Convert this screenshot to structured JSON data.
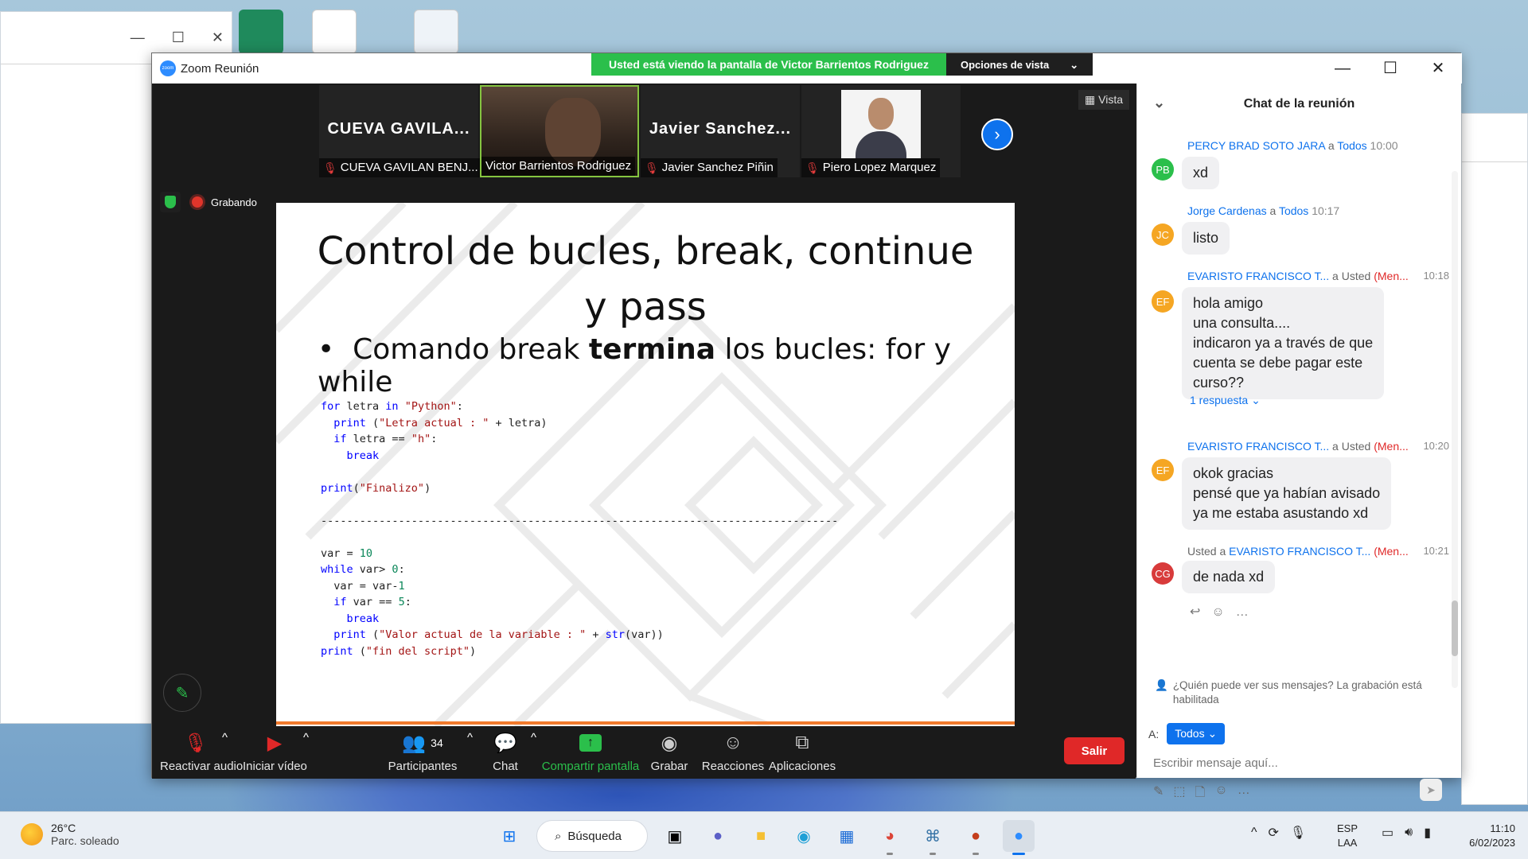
{
  "zoom": {
    "window_title": "Zoom Reunión",
    "logo_text": "zoom",
    "share_banner": "Usted está viendo la pantalla de Victor Barrientos Rodriguez",
    "view_options": "Opciones de vista",
    "view_label": "Vista",
    "recording_label": "Grabando"
  },
  "participants": [
    {
      "big_name": "CUEVA GAVILA...",
      "label": "CUEVA GAVILAN BENJ...",
      "muted": true
    },
    {
      "big_name": "",
      "label": "Victor Barrientos Rodriguez",
      "muted": false
    },
    {
      "big_name": "Javier Sanchez...",
      "label": "Javier Sanchez Piñin",
      "muted": true
    },
    {
      "big_name": "",
      "label": "Piero Lopez Marquez",
      "muted": true
    }
  ],
  "slide": {
    "title_line1": "Control de bucles, break, continue",
    "title_line2": "y pass",
    "bullet_pre": "Comando break ",
    "bullet_bold": "termina",
    "bullet_post": " los bucles: for y while",
    "separator": "--------------------------------------------------------------------------------"
  },
  "toolbar": {
    "audio": "Reactivar audio",
    "video": "Iniciar vídeo",
    "participants": "Participantes",
    "participants_count": "34",
    "chat": "Chat",
    "share": "Compartir pantalla",
    "record": "Grabar",
    "reactions": "Reacciones",
    "apps": "Aplicaciones",
    "leave": "Salir"
  },
  "chat": {
    "title": "Chat de la reunión",
    "messages": [
      {
        "initials": "PB",
        "color": "#2bbf4b",
        "sender": "PERCY BRAD SOTO JARA",
        "to_prefix": " a ",
        "to": "Todos",
        "private": "",
        "time": "10:00",
        "text": "xd"
      },
      {
        "initials": "JC",
        "color": "#f5a623",
        "sender": "Jorge Cardenas",
        "to_prefix": " a ",
        "to": "Todos",
        "private": "",
        "time": "10:17",
        "text": "listo"
      },
      {
        "initials": "EF",
        "color": "#f5a623",
        "sender": "EVARISTO FRANCISCO T...",
        "to_prefix": " a ",
        "to": "Usted",
        "private": "(Men...",
        "time": "10:18",
        "text": "hola amigo\nuna consulta....\nindicaron ya a través de que\ncuenta se debe pagar este\ncurso??",
        "reply": "1 respuesta"
      },
      {
        "initials": "EF",
        "color": "#f5a623",
        "sender": "EVARISTO FRANCISCO T...",
        "to_prefix": " a ",
        "to": "Usted",
        "private": "(Men...",
        "time": "10:20",
        "text": "okok gracias\npensé que ya habían avisado\nya me estaba asustando xd"
      },
      {
        "initials": "CG",
        "color": "#d83b3b",
        "sender_prefix": "Usted a ",
        "sender": "EVARISTO FRANCISCO T...",
        "to_prefix": "",
        "to": "",
        "private": "(Men...",
        "time": "10:21",
        "text": "de nada xd"
      }
    ],
    "notice": "¿Quién puede ver sus mensajes? La grabación está habilitada",
    "to_label": "A:",
    "to_value": "Todos",
    "placeholder": "Escribir mensaje aquí..."
  },
  "taskbar": {
    "temp": "26°C",
    "weather": "Parc. soleado",
    "search": "Búsqueda",
    "lang1": "ESP",
    "lang2": "LAA",
    "time": "11:10",
    "date": "6/02/2023"
  }
}
